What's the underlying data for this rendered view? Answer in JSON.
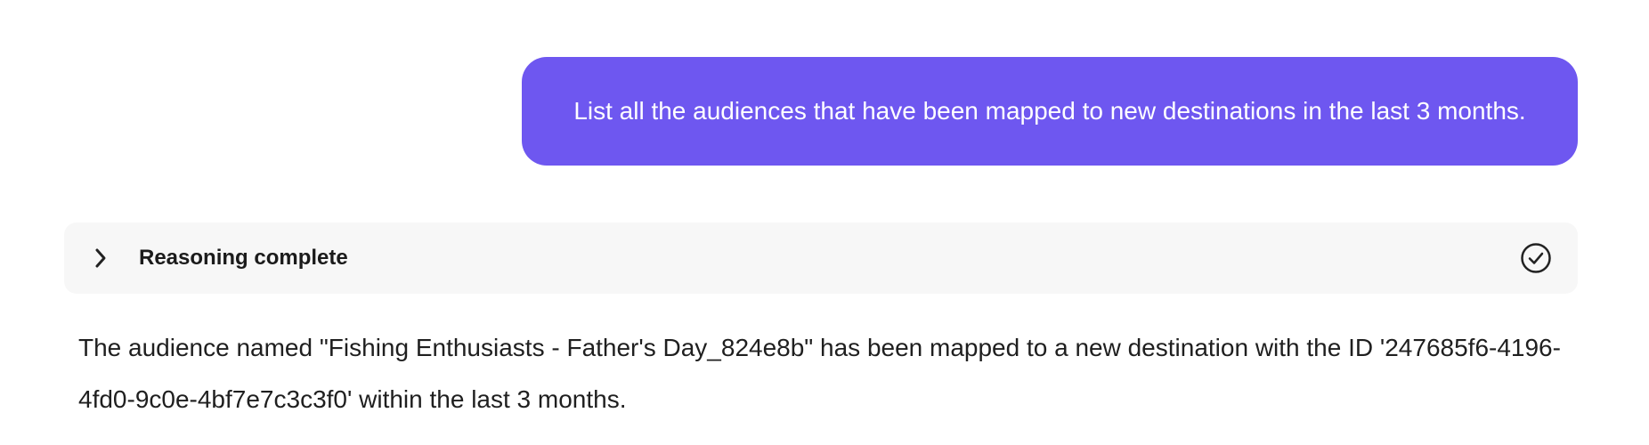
{
  "user_message": {
    "text": "List all the audiences that have been mapped to new destinations in the last 3 months."
  },
  "reasoning": {
    "label": "Reasoning complete",
    "toggle_icon": "chevron-right-icon",
    "status_icon": "check-circle-icon"
  },
  "assistant_message": {
    "text": "The audience named \"Fishing Enthusiasts - Father's Day_824e8b\" has been mapped to a new destination with the ID '247685f6-4196-4fd0-9c0e-4bf7e7c3c3f0' within the last 3 months."
  },
  "colors": {
    "user_bubble": "#6E57F0",
    "reasoning_bg": "#F7F7F7",
    "text": "#1f1f1f"
  }
}
